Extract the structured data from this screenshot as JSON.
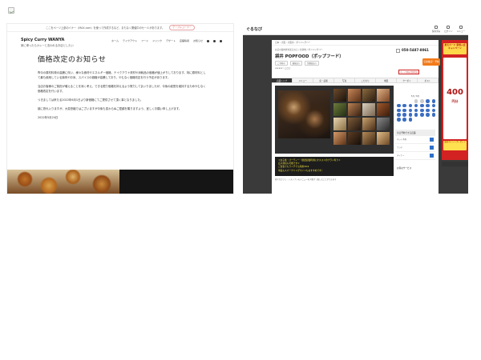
{
  "left": {
    "banner": {
      "text": "ここをページ上部のバナー（MAX.com）を使って作成するなど、まもなく開催中のセールがあります。",
      "button": "テーブルコーナー"
    },
    "brand": {
      "title": "Spicy Curry WANYA",
      "subtitle": "家に帰ったらカレーと言われるお店としたい"
    },
    "nav": [
      "ホーム",
      "テイクアウト",
      "フード",
      "ドリンク",
      "デザート",
      "店舗情報",
      "お知らせ"
    ],
    "notice": {
      "title": "価格改定のお知らせ",
      "paragraphs": [
        "昨今の原材料費の高騰に伴い、様々な食材やエネルギー価格、テイクアウト資材や消耗品の価格が値上がりしております。特に原材料として最も使用している鶏肉やお米、スパイスの価格が高騰しており、やむなく価格改定を行う予定があります。",
        "当店お客様のご負担が増えることを深く考え、できる限り価格を抑えるよう努力してまいりましたが、今後の経営を維持するためやむなく価格改定を行います。",
        "つきましては来たる2022年6月1日より新価格にてご提供させて頂く事となりました。",
        "誠に恐れ入りますが、大変恐縮ではございますが今後も変わらぬご愛顧を賜りますよう、宜しくお願い申し上げます。"
      ],
      "date": "2022年5月24日"
    }
  },
  "right": {
    "logo": "ぐるなび",
    "header_icons": [
      "保存済み",
      "ログイン",
      "メニュー"
    ],
    "crumb": "日本 › 大阪 › 大阪市 › ダイニングバー",
    "catline": "お店の案内状を送るなら / 北新地 / ダイニングバー",
    "restaurant_name": "袋井 POPFOOD（ポップフード）",
    "mini_labels": [
      "ご予約可",
      "個室あり",
      "禁煙席あり"
    ],
    "stars": "★★★★☆ 口コミ",
    "tel": "050-5487-8061",
    "reserve_button": "空席確認・予約する",
    "red_tag": "ネット予約の空席状況",
    "tabs": [
      "店舗トップ",
      "メニュー",
      "席・設備",
      "写真",
      "こだわり",
      "地図",
      "クーポン",
      "ポスト"
    ],
    "calendar_title": "5月 / 6月",
    "side_heading": "今日予約できる店舗",
    "side_rows": [
      "ネット予約",
      "ランチ",
      "ディナー"
    ],
    "side_heading2": "お得なサービス",
    "promo_lines": [
      "＊女子会・パーティー・歓送迎会利用にオススメのプラン有り＊",
      "広々貸切も可能です＊",
      "ご宴会でもランチでも利用OK★",
      "単品もスパークリングワインもおすすめです！"
    ],
    "footnote": "様々なカフェ・レストランのメニューを少量ずつ楽しむことができます",
    "ad": {
      "top": "楽天カード 新規入会 キャンペーン",
      "big_number": "400",
      "unit": "円分",
      "bottom": "楽天ポイントプレゼント"
    }
  }
}
